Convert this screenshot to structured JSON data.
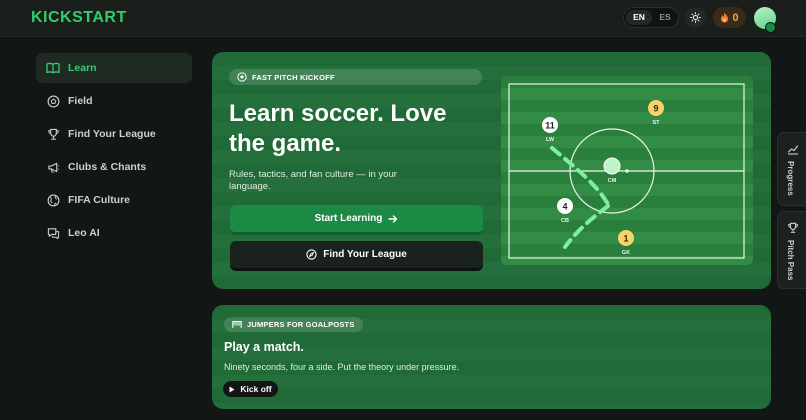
{
  "header": {
    "logo": "KICKSTART",
    "languages": [
      {
        "label": "EN",
        "active": true
      },
      {
        "label": "ES",
        "active": false
      }
    ],
    "theme_icon": "sun-icon",
    "streak_icon": "fire-icon",
    "streak_count": "0",
    "avatar_icon": "avatar"
  },
  "sidebar": {
    "items": [
      {
        "label": "Learn",
        "icon": "book-icon",
        "active": true
      },
      {
        "label": "Field",
        "icon": "soccer-ball-icon",
        "active": false
      },
      {
        "label": "Find Your League",
        "icon": "trophy-icon",
        "active": false
      },
      {
        "label": "Clubs & Chants",
        "icon": "megaphone-icon",
        "active": false
      },
      {
        "label": "FIFA Culture",
        "icon": "globe-icon",
        "active": false
      },
      {
        "label": "Leo AI",
        "icon": "chat-icon",
        "active": false
      }
    ]
  },
  "hero": {
    "badge": "FAST PITCH KICKOFF",
    "badge_icon": "soccer-ball-icon",
    "title": "Learn soccer. Love the game.",
    "subtitle": "Rules, tactics, and fan culture — in your language.",
    "primary_button": "Start Learning",
    "primary_icon": "arrow-right-icon",
    "secondary_button": "Find Your League",
    "secondary_icon": "compass-icon"
  },
  "pitch": {
    "players": [
      {
        "number": "11",
        "position": "LW"
      },
      {
        "number": "9",
        "position": "ST"
      },
      {
        "number": "",
        "position": "CM"
      },
      {
        "number": "4",
        "position": "CB"
      },
      {
        "number": "1",
        "position": "GK"
      }
    ]
  },
  "rail": {
    "progress_label": "Progress",
    "progress_icon": "chart-icon",
    "pass_label": "Pitch Pass",
    "pass_icon": "trophy-icon"
  },
  "match": {
    "badge": "JUMPERS FOR GOALPOSTS",
    "badge_icon": "goal-icon",
    "title": "Play a match.",
    "subtitle": "Ninety seconds, four a side. Put the theory under pressure.",
    "button": "Kick off",
    "button_icon": "play-icon"
  },
  "colors": {
    "accent": "#2fcf6a",
    "primary_button": "#1c8a45",
    "background": "#121614",
    "streak": "#f4a93b",
    "player_yellow": "#f7d26b"
  }
}
